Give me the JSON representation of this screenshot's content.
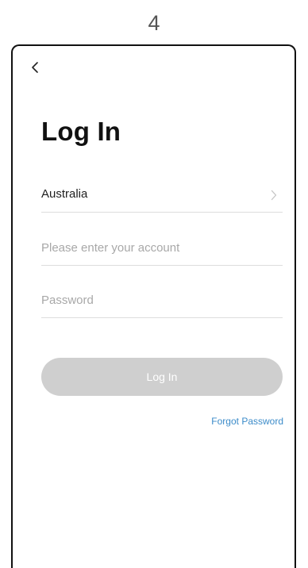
{
  "step": {
    "number": "4"
  },
  "nav": {
    "back_icon": "chevron-left-icon"
  },
  "login": {
    "title": "Log In",
    "country": {
      "value": "Australia",
      "icon": "chevron-right-icon"
    },
    "account": {
      "value": "",
      "placeholder": "Please enter your account"
    },
    "password": {
      "value": "",
      "placeholder": "Password"
    },
    "submit_label": "Log In",
    "forgot_label": "Forgot Password"
  },
  "colors": {
    "button_disabled": "#cfcfcf",
    "link": "#3b8bc9",
    "divider": "#dddddd",
    "placeholder": "#a8a8a8"
  }
}
